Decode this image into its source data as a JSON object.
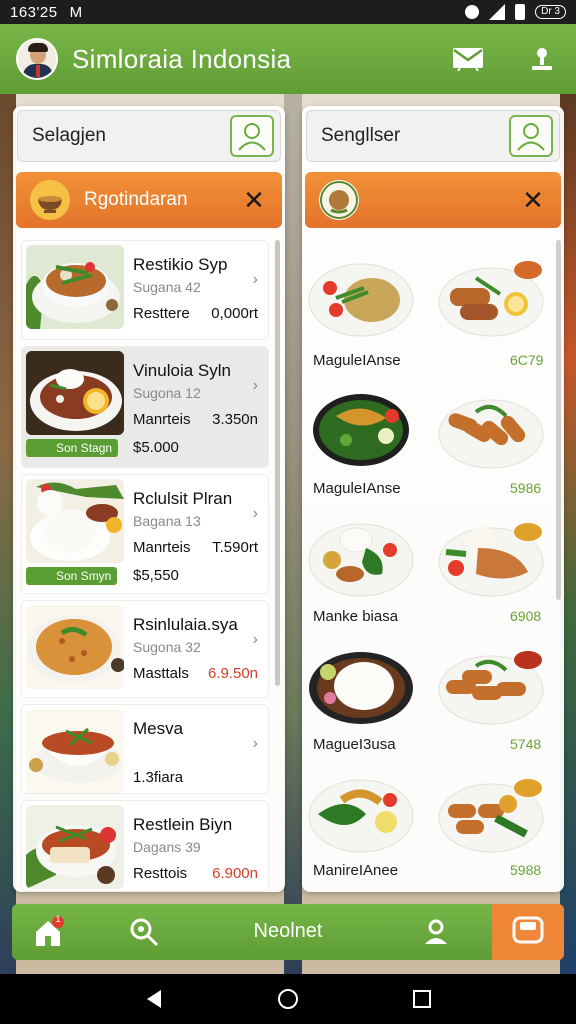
{
  "status": {
    "time": "163'25",
    "carrier": "M",
    "battery_label": "Dr 3"
  },
  "app": {
    "title": "Simloraia Indonsia"
  },
  "left_panel": {
    "search_label": "Selagjen",
    "category_title": "Rgotindaran",
    "items": [
      {
        "name": "Restikio Syp",
        "sub": "Sugana 42",
        "l3": "Resttere",
        "r3": "0,000rt",
        "r3_red": false
      },
      {
        "name": "Vinuloia Syln",
        "sub": "Sugona 12",
        "l3": "Manrteis",
        "r3": "3.350n",
        "r3_red": false,
        "badge": "Son Stagn",
        "l4": "$5.000"
      },
      {
        "name": "Rclulsit Plran",
        "sub": "Bagana 13",
        "l3": "Manrteis",
        "r3": "T.590rt",
        "r3_red": false,
        "badge": "Son Smyn",
        "l4": "$5,550"
      },
      {
        "name": "Rsinlulaia.sya",
        "sub": "Sugona 32",
        "l3": "Masttals",
        "r3": "6.9.50n",
        "r3_red": true
      },
      {
        "name": "Mesva",
        "sub": "",
        "l3": "1.3fiara",
        "r3": "",
        "r3_red": false
      },
      {
        "name": "Restlein Biyn",
        "sub": "Dagans 39",
        "l3": "Resttois",
        "r3": "6.900n",
        "r3_red": true
      }
    ]
  },
  "right_panel": {
    "search_label": "Sengllser",
    "grid": [
      {
        "label": "MaguleIAnse",
        "price": "6C79"
      },
      {
        "label": "MaguleIAnse",
        "price": "5986"
      },
      {
        "label": "Manke biasa",
        "price": "6908"
      },
      {
        "label": "MagueI3usa",
        "price": "5748"
      },
      {
        "label": "ManireIAnee",
        "price": "5988"
      }
    ]
  },
  "bottom_nav": {
    "label": "Neolnet",
    "home_badge": "1"
  },
  "colors": {
    "green": "#6aab3e",
    "orange": "#ee7f31",
    "price_red": "#d63c2a",
    "price_green": "#66a436"
  }
}
